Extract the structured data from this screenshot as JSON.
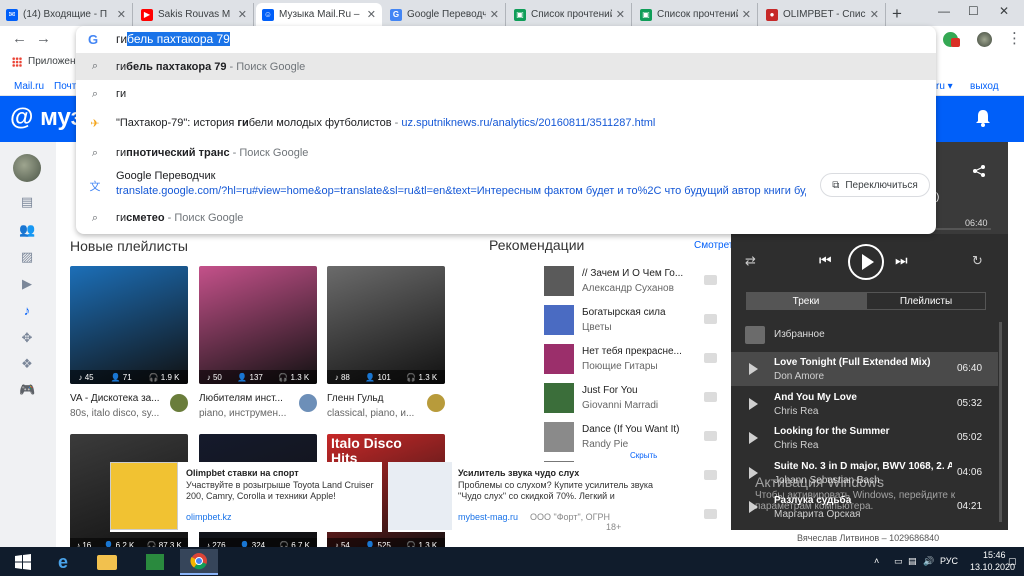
{
  "tabs": [
    {
      "title": "(14) Входящие - П",
      "favicon_color": "#005ff9",
      "favicon_text": "✉"
    },
    {
      "title": "Sakis Rouvas M",
      "favicon_color": "#ff0000",
      "favicon_text": "▶"
    },
    {
      "title": "Музыка Mail.Ru – ",
      "favicon_color": "#005ff9",
      "favicon_text": "☺",
      "active": true
    },
    {
      "title": "Google Переводчик",
      "favicon_color": "#4285f4",
      "favicon_text": "G"
    },
    {
      "title": "Список прочтений",
      "favicon_color": "#0f9d58",
      "favicon_text": "▣"
    },
    {
      "title": "Список прочтений",
      "favicon_color": "#0f9d58",
      "favicon_text": "▣"
    },
    {
      "title": "OLIMPBET - Списо",
      "favicon_color": "#c62828",
      "favicon_text": "●"
    }
  ],
  "omnibox": {
    "typed": "ги",
    "autocomplete": "бель пахтакора 79",
    "suggestions": [
      {
        "icon": "search-icon",
        "bold_prefix": "ги",
        "rest": "бель пахтакора 79",
        "suffix": " - Поиск Google",
        "highlighted": true
      },
      {
        "icon": "search-icon",
        "plain": "ги"
      },
      {
        "icon": "news-icon",
        "title_a": "\"Пахтакор-79\": история ",
        "title_b": "ги",
        "title_c": "бели молодых футболистов",
        "sep": " - ",
        "url": "uz.sputniknews.ru/analytics/20160811/3511287.html"
      },
      {
        "icon": "search-icon",
        "bold_prefix": "ги",
        "rest": "пнотический транс",
        "suffix": " - Поиск Google"
      },
      {
        "icon": "translate-icon",
        "title": "Google Переводчик",
        "url": "translate.google.com/?hl=ru#view=home&op=translate&sl=ru&tl=en&text=Интересным фактом будет и то%2C что будущий автор книги будет ..."
      },
      {
        "icon": "search-icon",
        "bold_prefix": "ги",
        "rest": "сметео",
        "suffix": " - Поиск Google"
      }
    ],
    "switch_button": "Переключиться"
  },
  "bookmarks": {
    "apps": "Приложен"
  },
  "mailbar": {
    "left_a": "Mail.ru",
    "left_b": "Почт",
    "right_a": "ru ▾",
    "right_b": "выход"
  },
  "header": {
    "logo": "@ муз"
  },
  "main": {
    "playlists_title": "Новые плейлисты",
    "playlists_row1": [
      {
        "name": "VA - Дискотека за...",
        "sub": "80s, italo disco, sy...",
        "stats": [
          "45",
          "71",
          "1.9 K"
        ],
        "color": "#1c6fb8"
      },
      {
        "name": "Любителям инст...",
        "sub": "piano, инструмен...",
        "stats": [
          "50",
          "137",
          "1.3 K"
        ],
        "color": "#c4518a"
      },
      {
        "name": "Гленн Гульд",
        "sub": "classical, piano, и...",
        "stats": [
          "88",
          "101",
          "1.3 K"
        ],
        "color": "#6b6b6b"
      }
    ],
    "playlists_row2": [
      {
        "stats": [
          "16",
          "6.2 K",
          "87.3 K"
        ],
        "color": "#3b3b3b"
      },
      {
        "stats": [
          "276",
          "324",
          "6.7 K"
        ],
        "color": "#151a2c"
      },
      {
        "stats": [
          "54",
          "525",
          "1.3 K"
        ],
        "color": "#c62828",
        "overlay_text": "Italo Disco Hits"
      }
    ],
    "reco_title": "Рекомендации",
    "reco_all": "Смотреть всё",
    "reco_hide": "Скрыть",
    "reco": [
      {
        "title": "// Зачем И О Чем Го...",
        "artist": "Александр Суханов",
        "dur": "02:18",
        "color": "#5a5a5a"
      },
      {
        "title": "Богатырская сила",
        "artist": "Цветы",
        "dur": "03:53",
        "color": "#4a6bc2"
      },
      {
        "title": "Нет тебя прекрасне...",
        "artist": "Поющие Гитары",
        "dur": "03:11",
        "color": "#9b2f6b"
      },
      {
        "title": "Just For You",
        "artist": "Giovanni Marradi",
        "dur": "04:18",
        "color": "#3b6e3a"
      },
      {
        "title": "Dance (If You Want It)",
        "artist": "Randy Pie",
        "dur": "05:43",
        "color": "#8a8a8a"
      },
      {
        "dur": "03:29",
        "color": "#777777"
      },
      {
        "dur": "02:55",
        "color": "#777777"
      }
    ]
  },
  "player": {
    "time_suffix": "x)",
    "time": "06:40",
    "tabs": [
      "Треки",
      "Плейлисты"
    ],
    "favorites": "Избранное",
    "queue": [
      {
        "name": "Love Tonight (Full Extended Mix)",
        "artist": "Don Amore",
        "dur": "06:40",
        "current": true
      },
      {
        "name": "And You My Love",
        "artist": "Chris Rea",
        "dur": "05:32"
      },
      {
        "name": "Looking for the Summer",
        "artist": "Chris Rea",
        "dur": "05:02"
      },
      {
        "name": "Suite No. 3 in D major, BWV 1068, 2. Air",
        "artist": "Johann Sebastian Bach",
        "dur": "04:06"
      },
      {
        "name": "Разлука судьба",
        "artist": "Маргарита Орская",
        "dur": "04:21"
      }
    ]
  },
  "watermark": {
    "line1": "Активация Windows",
    "line2": "Чтобы активировать Windows, перейдите к",
    "line3": "параметрам компьютера."
  },
  "ads": [
    {
      "title": "Olimpbet ставки на спорт",
      "body": "Участвуйте в розыгрыше Toyota Land Cruiser 200, Camry, Corolla и техники Apple!",
      "domain": "olimpbet.kz"
    },
    {
      "title": "Усилитель звука чудо слух",
      "body": "Проблемы со слухом? Купите усилитель звука \"Чудо слух\" со скидкой 70%. Легкий и",
      "domain": "mybest-mag.ru",
      "extra": "ООО \"Форт\", ОГРН",
      "age": "18+"
    }
  ],
  "userline": "Вячеслав Литвинов – 1029686840",
  "taskbar": {
    "lang": "РУС",
    "time": "15:46",
    "date": "13.10.2020"
  }
}
